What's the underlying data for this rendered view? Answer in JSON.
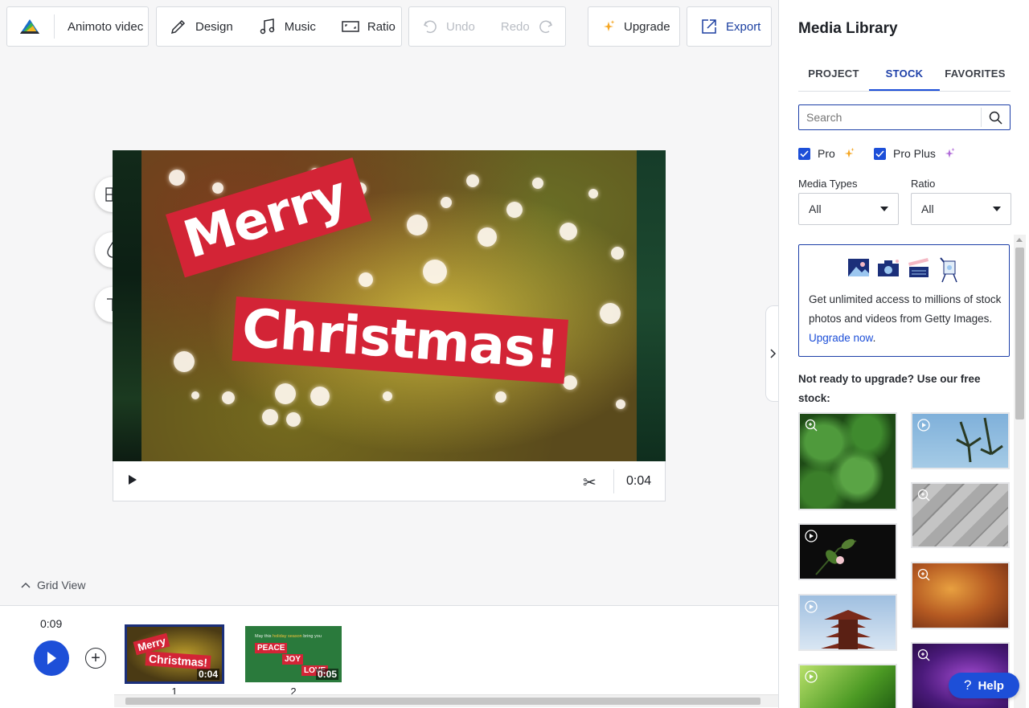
{
  "toolbar": {
    "project_name": "Animoto videc",
    "design_label": "Design",
    "music_label": "Music",
    "ratio_label": "Ratio",
    "undo_label": "Undo",
    "redo_label": "Redo",
    "upgrade_label": "Upgrade",
    "export_label": "Export"
  },
  "preview": {
    "banner_line1": "Merry",
    "banner_line2": "Christmas!",
    "duration": "0:04",
    "icons": [
      "layout-icon",
      "color-drop-icon",
      "text-icon",
      "scissors-icon",
      "play-icon"
    ]
  },
  "timeline": {
    "grid_view_label": "Grid View",
    "total_duration": "0:09",
    "scenes": [
      {
        "number": "1",
        "duration": "0:04",
        "caption_line1": "Merry",
        "caption_line2": "Christmas!"
      },
      {
        "number": "2",
        "duration": "0:05",
        "caption_top_a": "May this ",
        "caption_top_b": "holiday season",
        "caption_top_c": " bring you",
        "words": [
          "PEACE",
          "JOY",
          "LOVE"
        ]
      }
    ]
  },
  "media_library": {
    "title": "Media Library",
    "tabs": [
      "PROJECT",
      "STOCK",
      "FAVORITES"
    ],
    "active_tab": "STOCK",
    "search_placeholder": "Search",
    "checkboxes": [
      {
        "label": "Pro",
        "checked": true
      },
      {
        "label": "Pro Plus",
        "checked": true
      }
    ],
    "media_types_label": "Media Types",
    "media_types_value": "All",
    "ratio_label": "Ratio",
    "ratio_value": "All",
    "promo_text": "Get unlimited access to millions of stock photos and videos from Getty Images. ",
    "promo_link": "Upgrade now",
    "promo_tail": ".",
    "free_stock_text": "Not ready to upgrade? Use our free stock:",
    "tiles": [
      {
        "subject": "basil leaves",
        "kind": "photo"
      },
      {
        "subject": "palm trees sky",
        "kind": "video"
      },
      {
        "subject": "wooden boards",
        "kind": "photo"
      },
      {
        "subject": "flower branch",
        "kind": "video"
      },
      {
        "subject": "autumn leaves",
        "kind": "photo"
      },
      {
        "subject": "pagoda",
        "kind": "video"
      },
      {
        "subject": "purple sky",
        "kind": "photo"
      },
      {
        "subject": "green leaf",
        "kind": "video"
      }
    ]
  },
  "help_label": "Help",
  "colors": {
    "accent": "#1d4fd8",
    "banner": "#d32436",
    "navy": "#1b2f7a"
  }
}
